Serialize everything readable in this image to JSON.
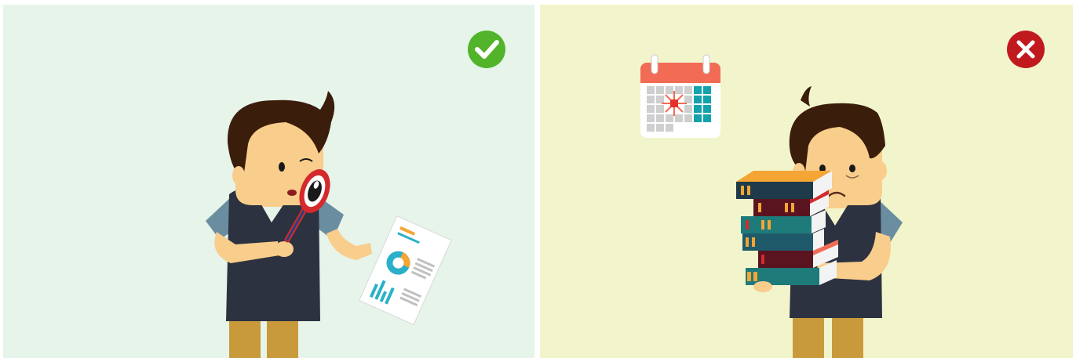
{
  "colors": {
    "left_background": "#e6f4ea",
    "right_background": "#f2f5cb",
    "check_badge": "#52b42a",
    "cross_badge": "#c01a1f",
    "hair": "#3b1d0b",
    "skin": "#f9cd8b",
    "vest": "#2c3240",
    "sleeve": "#6b8da0",
    "pants": "#c99a3c",
    "magnifier_ring": "#d42a2d",
    "calendar_header": "#f26b55",
    "calendar_highlight": "#14a3ac"
  },
  "panels": [
    {
      "id": "left",
      "badge_icon": "check-icon",
      "illustration": "person-inspecting-report-with-magnifier"
    },
    {
      "id": "right",
      "badge_icon": "cross-icon",
      "illustration": "person-carrying-stack-of-books"
    }
  ],
  "calendar": {
    "icon": "calendar-icon",
    "highlighted_day": "star-burst"
  }
}
